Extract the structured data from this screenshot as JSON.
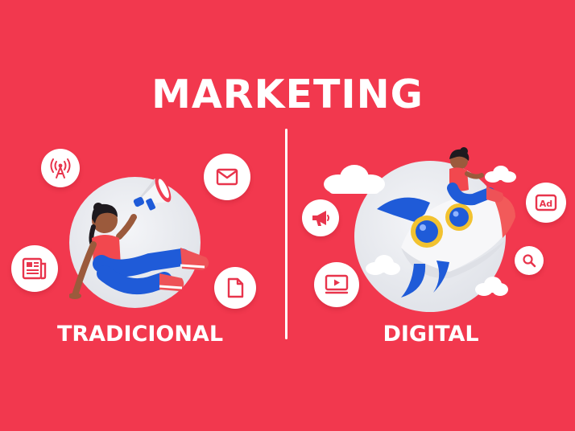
{
  "title": "MARKETING",
  "sections": {
    "traditional": {
      "label": "TRADICIONAL",
      "icons": [
        "broadcast-antenna-icon",
        "mail-envelope-icon",
        "newspaper-icon",
        "document-file-icon"
      ]
    },
    "digital": {
      "label": "DIGITAL",
      "icons": [
        "megaphone-icon",
        "ad-badge-icon",
        "search-magnifier-icon",
        "video-player-icon"
      ],
      "ad_badge_text": "Ad"
    }
  },
  "colors": {
    "background": "#F2384E",
    "accent": "#E8344C",
    "circle": "#E2E4EA",
    "white": "#FFFFFF",
    "rocket_blue": "#1F5BD8",
    "rocket_nose": "#F25A5A"
  }
}
